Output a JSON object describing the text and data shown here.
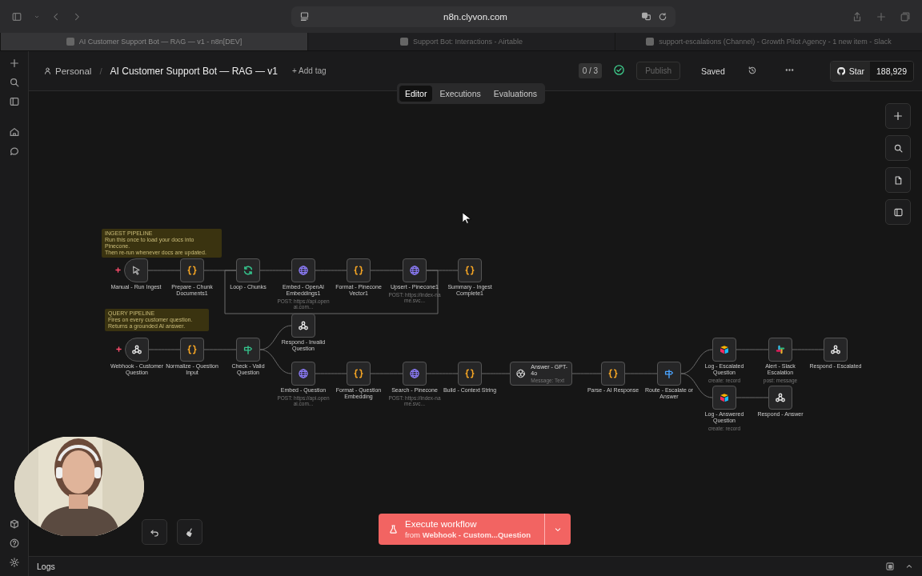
{
  "browser": {
    "url": "n8n.clyvon.com",
    "tabs": [
      {
        "title": "AI Customer Support Bot — RAG — v1 - n8n[DEV]",
        "selected": true
      },
      {
        "title": "Support Bot: Interactions - Airtable",
        "selected": false
      },
      {
        "title": "support-escalations (Channel) - Growth Pilot Agency - 1 new item - Slack",
        "selected": false
      }
    ]
  },
  "header": {
    "breadcrumb": "Personal",
    "separator": "/",
    "title": "AI Customer Support Bot — RAG — v1",
    "add_tag": "+ Add tag",
    "counter": "0 / 3",
    "publish": {
      "label": "Publish",
      "disabled": true
    },
    "status": "Saved",
    "github": {
      "label": "Star",
      "count": "188,929"
    }
  },
  "view_tabs": [
    {
      "label": "Editor",
      "selected": true
    },
    {
      "label": "Executions",
      "selected": false
    },
    {
      "label": "Evaluations",
      "selected": false
    }
  ],
  "canvas": {
    "notes": [
      {
        "title": "INGEST PIPELINE",
        "lines": [
          "Run this once to load your docs into Pinecone.",
          "Then re-run whenever docs are updated."
        ]
      },
      {
        "title": "QUERY PIPELINE",
        "lines": [
          "Fires on every customer question.",
          "Returns a grounded AI answer."
        ]
      }
    ],
    "nodes": [
      {
        "label": "Manual - Run Ingest",
        "kind": "cursor",
        "trigger": true
      },
      {
        "label": "Prepare - Chunk Documents1",
        "kind": "braces",
        "trigger": false
      },
      {
        "label": "Loop - Chunks",
        "kind": "loop",
        "trigger": false
      },
      {
        "label": "Embed - OpenAI Embeddings1",
        "subtitle": "POST: https://api.openai.com...",
        "kind": "globe",
        "trigger": false
      },
      {
        "label": "Format - Pinecone Vector1",
        "kind": "braces",
        "trigger": false
      },
      {
        "label": "Upsert - Pinecone1",
        "subtitle": "POST: https://index-name.svc...",
        "kind": "globe",
        "trigger": false
      },
      {
        "label": "Summary - Ingest Complete1",
        "kind": "braces",
        "trigger": false
      },
      {
        "label": "Webhook - Customer Question",
        "kind": "webhook",
        "trigger": true
      },
      {
        "label": "Normalize - Question Input",
        "kind": "braces",
        "trigger": false
      },
      {
        "label": "Check - Valid Question",
        "kind": "filter",
        "trigger": false
      },
      {
        "label": "Respond - Invalid Question",
        "kind": "webhook",
        "trigger": false
      },
      {
        "label": "Embed - Question",
        "subtitle": "POST: https://api.openai.com...",
        "kind": "globe",
        "trigger": false
      },
      {
        "label": "Format - Question Embedding",
        "kind": "braces",
        "trigger": false
      },
      {
        "label": "Search - Pinecone",
        "subtitle": "POST: https://index-name.svc...",
        "kind": "globe",
        "trigger": false
      },
      {
        "label": "Build - Context String",
        "kind": "braces",
        "trigger": false
      },
      {
        "label": "Answer - GPT-4o",
        "subtitle": "Message: Text",
        "kind": "openai",
        "trigger": false
      },
      {
        "label": "Parse - AI Response",
        "kind": "braces",
        "trigger": false
      },
      {
        "label": "Route - Escalate or Answer",
        "kind": "switch",
        "trigger": false
      },
      {
        "label": "Log - Escalated Question",
        "subtitle": "create: record",
        "kind": "airtable",
        "trigger": false
      },
      {
        "label": "Alert - Slack Escalation",
        "subtitle": "post: message",
        "kind": "slack",
        "trigger": false
      },
      {
        "label": "Respond - Escalated",
        "kind": "webhook",
        "trigger": false
      },
      {
        "label": "Log - Answered Question",
        "subtitle": "create: record",
        "kind": "airtable",
        "trigger": false
      },
      {
        "label": "Respond - Answer",
        "kind": "webhook",
        "trigger": false
      }
    ]
  },
  "execute": {
    "label": "Execute workflow",
    "from": "from **Webhook - Custom...Question**"
  },
  "logs": {
    "label": "Logs"
  }
}
